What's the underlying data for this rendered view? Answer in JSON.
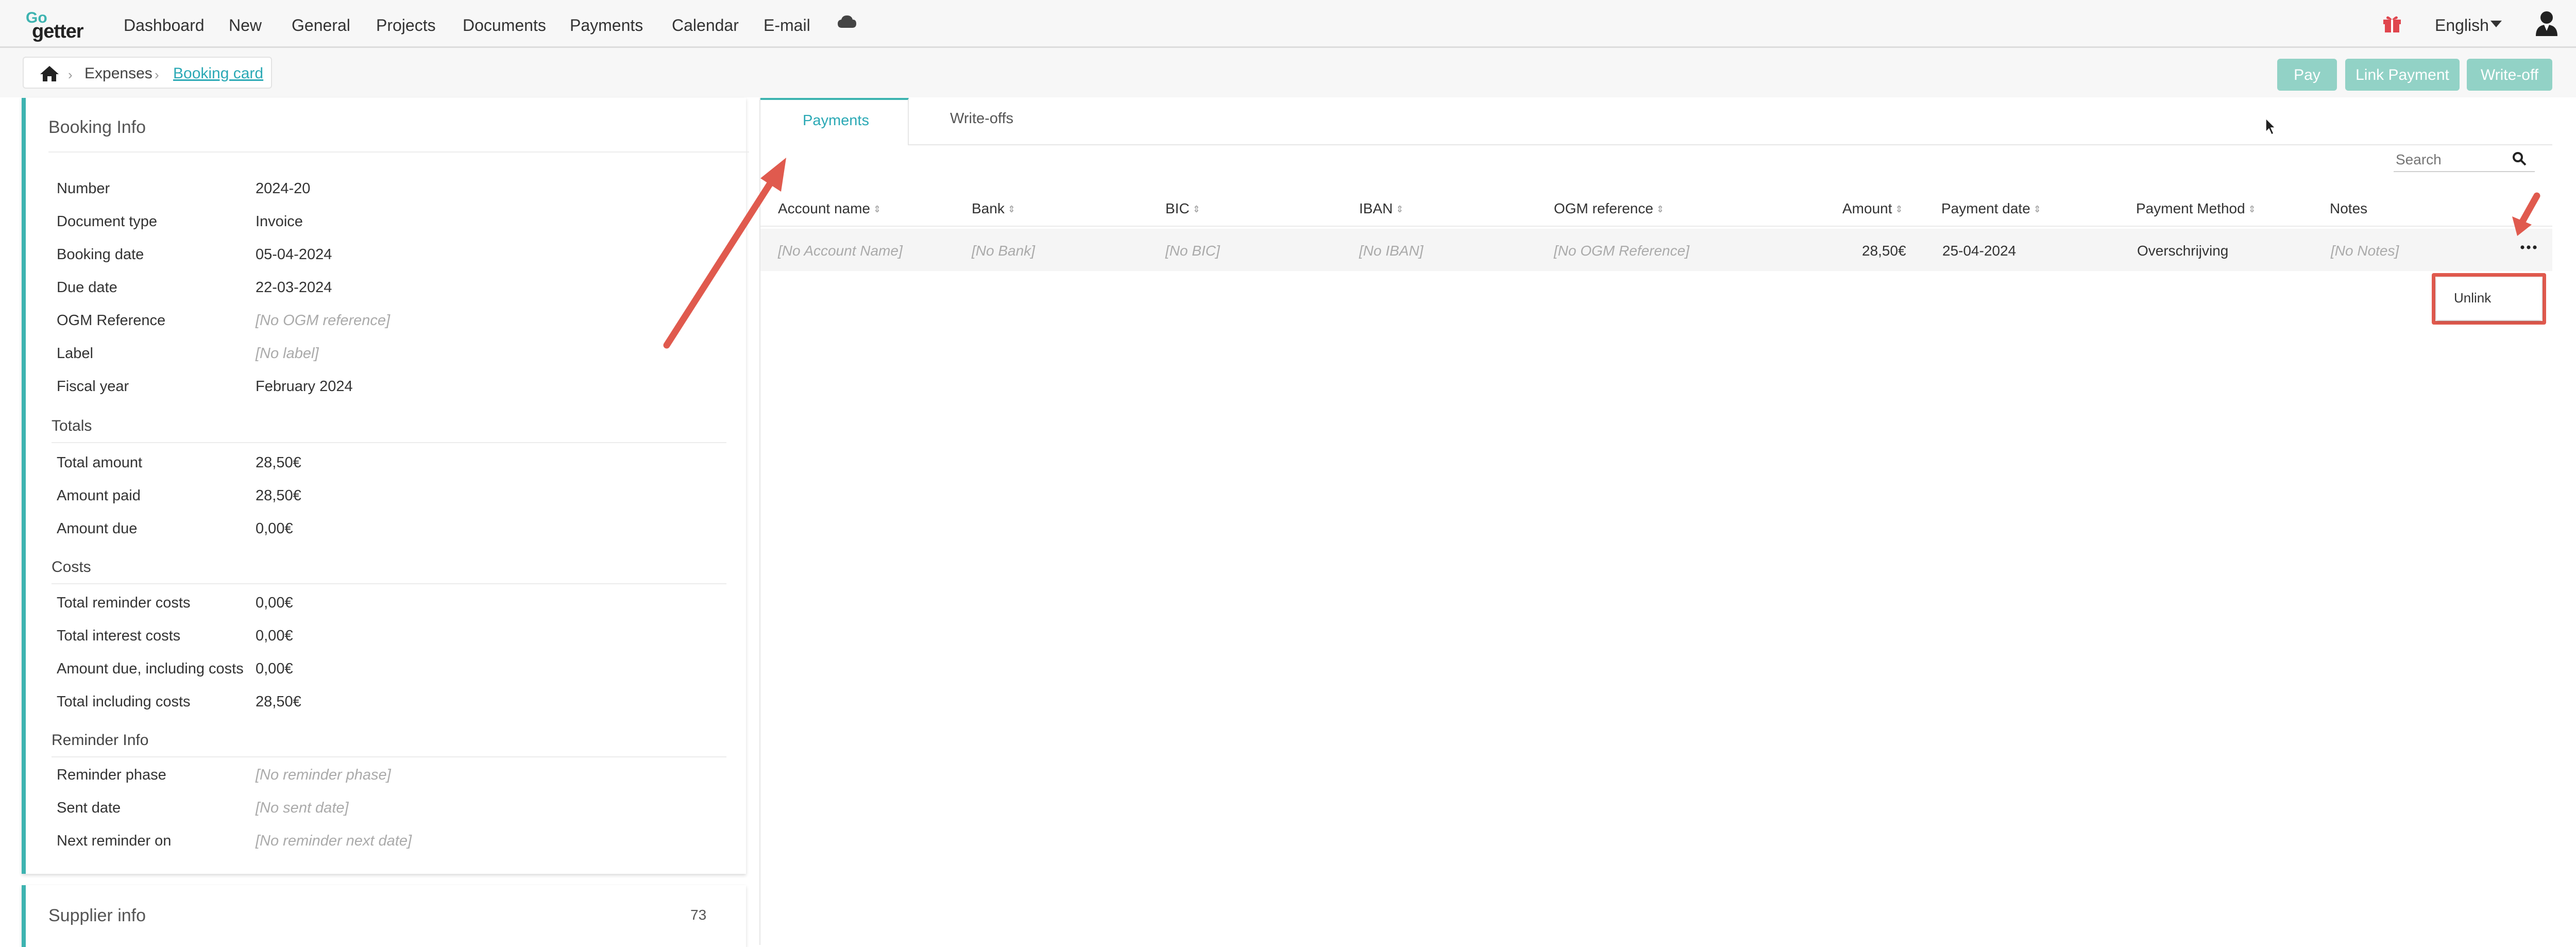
{
  "app": {
    "brand_top": "Go",
    "brand_bottom": "getter",
    "accent_color": "#3db3b0",
    "button_color": "#92d2c6"
  },
  "nav": {
    "items": [
      "Dashboard",
      "New",
      "General",
      "Projects",
      "Documents",
      "Payments",
      "Calendar",
      "E-mail"
    ],
    "cloud_icon": "cloud-icon",
    "gift_icon": "gift-icon",
    "language": "English",
    "user_icon": "user-icon"
  },
  "breadcrumb": {
    "home_icon": "home-icon",
    "items": [
      "Expenses",
      "Booking card"
    ]
  },
  "actions": {
    "pay": "Pay",
    "link_payment": "Link Payment",
    "write_off": "Write-off"
  },
  "booking_info": {
    "title": "Booking Info",
    "rows": [
      {
        "label": "Number",
        "value": "2024-20"
      },
      {
        "label": "Document type",
        "value": "Invoice"
      },
      {
        "label": "Booking date",
        "value": "05-04-2024"
      },
      {
        "label": "Due date",
        "value": "22-03-2024"
      },
      {
        "label": "OGM Reference",
        "value": "[No OGM reference]"
      },
      {
        "label": "Label",
        "value": "[No label]"
      },
      {
        "label": "Fiscal year",
        "value": "February 2024"
      }
    ],
    "totals_title": "Totals",
    "totals": [
      {
        "label": "Total amount",
        "value": "28,50€"
      },
      {
        "label": "Amount paid",
        "value": "28,50€"
      },
      {
        "label": "Amount due",
        "value": "0,00€"
      }
    ],
    "costs_title": "Costs",
    "costs": [
      {
        "label": "Total reminder costs",
        "value": "0,00€"
      },
      {
        "label": "Total interest costs",
        "value": "0,00€"
      },
      {
        "label": "Amount due, including costs",
        "value": "0,00€"
      },
      {
        "label": "Total including costs",
        "value": "28,50€"
      }
    ],
    "reminder_title": "Reminder Info",
    "reminder": [
      {
        "label": "Reminder phase",
        "value": "[No reminder phase]"
      },
      {
        "label": "Sent date",
        "value": "[No sent date]"
      },
      {
        "label": "Next reminder on",
        "value": "[No reminder next date]"
      }
    ]
  },
  "supplier_info": {
    "title": "Supplier info",
    "count": "73"
  },
  "tabs": [
    "Payments",
    "Write-offs"
  ],
  "search": {
    "placeholder": "Search"
  },
  "table": {
    "headers": [
      "Account name",
      "Bank",
      "BIC",
      "IBAN",
      "OGM reference",
      "Amount",
      "Payment date",
      "Payment Method",
      "Notes"
    ],
    "rows": [
      [
        "[No Account Name]",
        "[No Bank]",
        "[No BIC]",
        "[No IBAN]",
        "[No OGM Reference]",
        "28,50€",
        "25-04-2024",
        "Overschrijving",
        "[No Notes]"
      ]
    ]
  },
  "row_menu": {
    "icon": "more-icon",
    "items": [
      "Unlink"
    ]
  },
  "annotation_color": "#e05a4e"
}
